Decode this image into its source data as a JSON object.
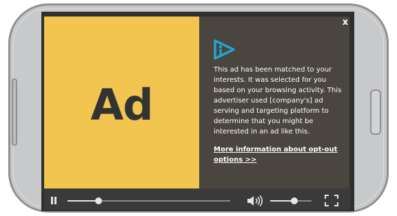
{
  "ad_panel": {
    "label": "Ad",
    "background_color": "#f1c54f"
  },
  "info_panel": {
    "close_label": "x",
    "logo_icon": "adchoices-play-icon",
    "logo_color": "#1ea7d8",
    "text": "This ad has been matched to your interests. It was selected for you based on your browsing activity. This advertiser used [company's] ad serving and targeting platform to determine that you might be interested in an ad like this.",
    "link_label": "More information about opt-out options >>"
  },
  "player_controls": {
    "pause_icon": "pause-icon",
    "volume_icon": "speaker-icon",
    "fullscreen_icon": "fullscreen-icon",
    "seek_progress": 0.19,
    "volume_level": 0.58
  }
}
